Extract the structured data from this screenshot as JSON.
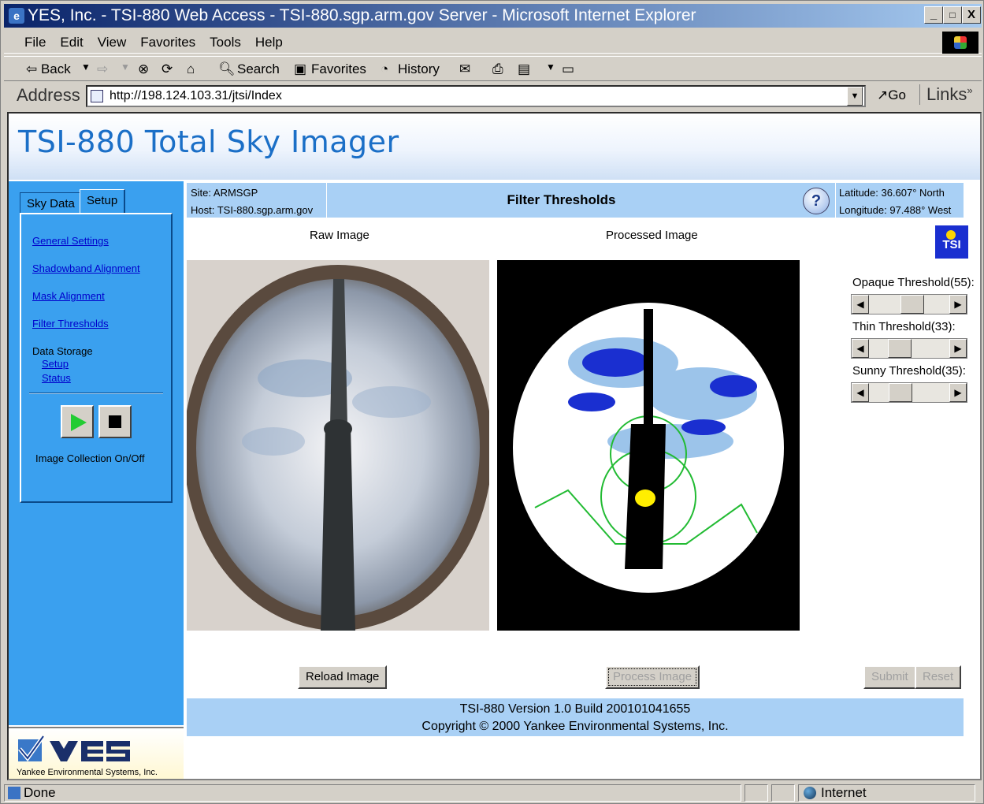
{
  "window": {
    "title": "YES, Inc. - TSI-880 Web Access - TSI-880.sgp.arm.gov Server - Microsoft Internet Explorer",
    "min": "_",
    "max": "□",
    "close": "X"
  },
  "menu": [
    "File",
    "Edit",
    "View",
    "Favorites",
    "Tools",
    "Help"
  ],
  "toolbar": {
    "back": "⇦ Back",
    "search": "Search",
    "favorites": "Favorites",
    "history": "History"
  },
  "address": {
    "label": "Address",
    "url": "http://198.124.103.31/jtsi/Index",
    "go": "Go",
    "links": "Links"
  },
  "page": {
    "title": "TSI-880 Total Sky Imager"
  },
  "tabs": [
    {
      "label": "Sky Data"
    },
    {
      "label": "Setup"
    }
  ],
  "nav": {
    "general_settings": "General Settings",
    "shadowband_alignment": "Shadowband Alignment",
    "mask_alignment": "Mask Alignment",
    "filter_thresholds": "Filter Thresholds",
    "data_storage": "Data Storage",
    "setup": "Setup",
    "status": "Status",
    "collection_label": "Image Collection On/Off"
  },
  "logo": {
    "company": "Yankee Environmental Systems, Inc."
  },
  "info": {
    "site": "Site: ARMSGP",
    "host": "Host: TSI-880.sgp.arm.gov",
    "heading": "Filter Thresholds",
    "help": "?",
    "latitude": "Latitude: 36.607° North",
    "longitude": "Longitude: 97.488° West"
  },
  "images": {
    "raw_label": "Raw Image",
    "processed_label": "Processed Image",
    "tsi_logo": "TSI"
  },
  "thresholds": [
    {
      "label": "Opaque Threshold(55):",
      "value": 55
    },
    {
      "label": "Thin Threshold(33):",
      "value": 33
    },
    {
      "label": "Sunny Threshold(35):",
      "value": 35
    }
  ],
  "buttons": {
    "reload": "Reload Image",
    "process": "Process Image",
    "submit": "Submit",
    "reset": "Reset"
  },
  "footer": {
    "version": "TSI-880 Version 1.0 Build 200101041655",
    "copyright": "Copyright © 2000 Yankee Environmental Systems, Inc."
  },
  "statusbar": {
    "text": "Done",
    "zone": "Internet"
  },
  "colors": {
    "accent": "#3aa0ef",
    "title": "#1b6fc7",
    "infobar": "#a9d0f5"
  }
}
